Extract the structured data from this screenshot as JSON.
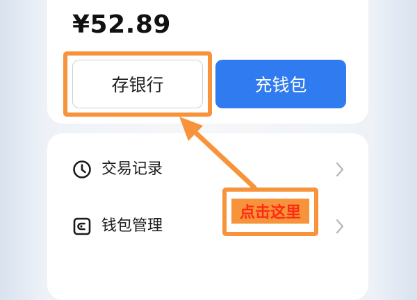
{
  "wallet": {
    "balance": "¥52.89"
  },
  "actions": {
    "save_to_bank_label": "存银行",
    "top_up_label": "充钱包"
  },
  "menu": {
    "items": [
      {
        "label": "交易记录",
        "icon": "clock-icon"
      },
      {
        "label": "钱包管理",
        "icon": "wallet-icon"
      }
    ]
  },
  "annotation": {
    "callout_text": "点击这里"
  },
  "colors": {
    "primary_blue": "#2f7bef",
    "highlight_orange": "#f7943b",
    "callout_text_red": "#ff2a12"
  }
}
